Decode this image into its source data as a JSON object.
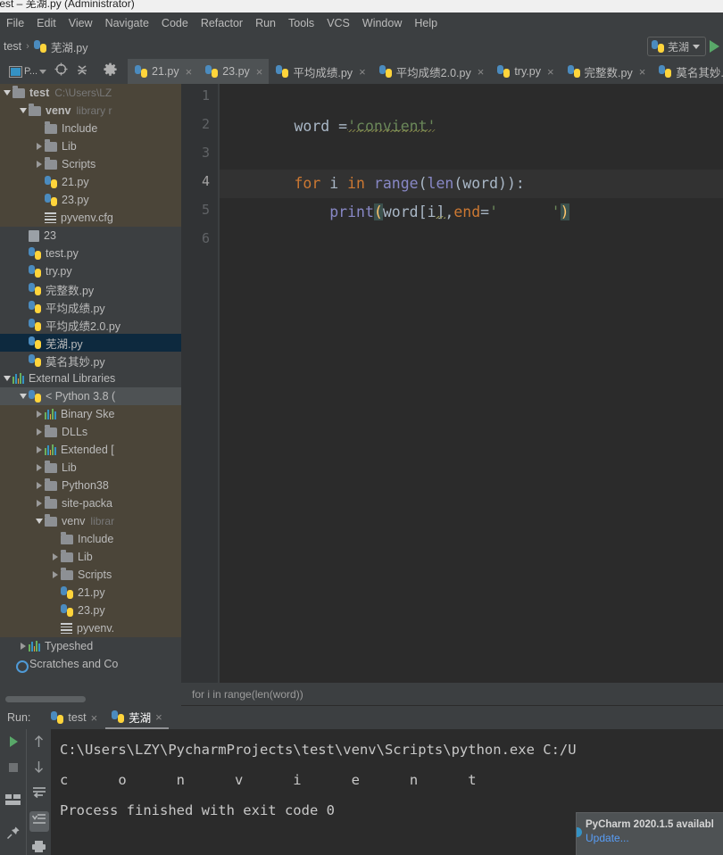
{
  "window": {
    "title": "test – 芜湖.py (Administrator)"
  },
  "menubar": {
    "items": [
      {
        "label": "File"
      },
      {
        "label": "Edit"
      },
      {
        "label": "View"
      },
      {
        "label": "Navigate"
      },
      {
        "label": "Code"
      },
      {
        "label": "Refactor"
      },
      {
        "label": "Run"
      },
      {
        "label": "Tools"
      },
      {
        "label": "VCS"
      },
      {
        "label": "Window"
      },
      {
        "label": "Help"
      }
    ]
  },
  "navbar": {
    "crumbs": [
      "test",
      "芜湖.py"
    ],
    "separator": "›",
    "run_config": "芜湖"
  },
  "toolbar": {
    "project_label": "P...",
    "icons": [
      "project-icon",
      "target-icon",
      "collapse-icon",
      "settings-gear-icon"
    ]
  },
  "tabs": [
    {
      "label": "21.py",
      "active": true
    },
    {
      "label": "23.py",
      "active": true
    },
    {
      "label": "平均成绩.py",
      "active": false
    },
    {
      "label": "平均成绩2.0.py",
      "active": false
    },
    {
      "label": "try.py",
      "active": false
    },
    {
      "label": "完整数.py",
      "active": false
    },
    {
      "label": "莫名其妙.py",
      "active": false
    }
  ],
  "project_tree": [
    {
      "depth": 0,
      "twisty": "down",
      "icon": "folder",
      "label": "test",
      "dim": "C:\\Users\\LZ",
      "bold": true,
      "state": "mod"
    },
    {
      "depth": 1,
      "twisty": "down",
      "icon": "folder",
      "label": "venv",
      "dim": "library r",
      "bold": true,
      "state": "mod"
    },
    {
      "depth": 2,
      "twisty": "none",
      "icon": "folder",
      "label": "Include",
      "dim": "",
      "state": "mod"
    },
    {
      "depth": 2,
      "twisty": "right",
      "icon": "folder",
      "label": "Lib",
      "dim": "",
      "state": "mod"
    },
    {
      "depth": 2,
      "twisty": "right",
      "icon": "folder",
      "label": "Scripts",
      "dim": "",
      "state": "mod"
    },
    {
      "depth": 2,
      "twisty": "none",
      "icon": "python",
      "label": "21.py",
      "dim": "",
      "state": "mod"
    },
    {
      "depth": 2,
      "twisty": "none",
      "icon": "python",
      "label": "23.py",
      "dim": "",
      "state": "mod"
    },
    {
      "depth": 2,
      "twisty": "none",
      "icon": "config",
      "label": "pyvenv.cfg",
      "dim": "",
      "state": "mod"
    },
    {
      "depth": 1,
      "twisty": "none",
      "icon": "text",
      "label": "23",
      "dim": "",
      "state": "none"
    },
    {
      "depth": 1,
      "twisty": "none",
      "icon": "python",
      "label": "test.py",
      "dim": "",
      "state": "none"
    },
    {
      "depth": 1,
      "twisty": "none",
      "icon": "python",
      "label": "try.py",
      "dim": "",
      "state": "none"
    },
    {
      "depth": 1,
      "twisty": "none",
      "icon": "python",
      "label": "完整数.py",
      "dim": "",
      "state": "none"
    },
    {
      "depth": 1,
      "twisty": "none",
      "icon": "python",
      "label": "平均成绩.py",
      "dim": "",
      "state": "none"
    },
    {
      "depth": 1,
      "twisty": "none",
      "icon": "python",
      "label": "平均成绩2.0.py",
      "dim": "",
      "state": "none"
    },
    {
      "depth": 1,
      "twisty": "none",
      "icon": "python",
      "label": "芜湖.py",
      "dim": "",
      "state": "sel"
    },
    {
      "depth": 1,
      "twisty": "none",
      "icon": "python",
      "label": "莫名其妙.py",
      "dim": "",
      "state": "none"
    },
    {
      "depth": 0,
      "twisty": "down",
      "icon": "lib",
      "label": "External Libraries",
      "dim": "",
      "state": "none"
    },
    {
      "depth": 1,
      "twisty": "down",
      "icon": "python",
      "label": "< Python 3.8 (",
      "dim": "",
      "state": "sel-gray"
    },
    {
      "depth": 2,
      "twisty": "right",
      "icon": "lib",
      "label": "Binary Ske",
      "dim": "",
      "state": "mod"
    },
    {
      "depth": 2,
      "twisty": "right",
      "icon": "folder",
      "label": "DLLs",
      "dim": "",
      "state": "mod"
    },
    {
      "depth": 2,
      "twisty": "right",
      "icon": "lib",
      "label": "Extended [",
      "dim": "",
      "state": "mod"
    },
    {
      "depth": 2,
      "twisty": "right",
      "icon": "folder",
      "label": "Lib",
      "dim": "",
      "state": "mod"
    },
    {
      "depth": 2,
      "twisty": "right",
      "icon": "folder",
      "label": "Python38",
      "dim": "",
      "state": "mod"
    },
    {
      "depth": 2,
      "twisty": "right",
      "icon": "folder",
      "label": "site-packa",
      "dim": "",
      "state": "mod"
    },
    {
      "depth": 2,
      "twisty": "down",
      "icon": "folder",
      "label": "venv",
      "dim": "librar",
      "state": "mod"
    },
    {
      "depth": 3,
      "twisty": "none",
      "icon": "folder",
      "label": "Include",
      "dim": "",
      "state": "mod"
    },
    {
      "depth": 3,
      "twisty": "right",
      "icon": "folder",
      "label": "Lib",
      "dim": "",
      "state": "mod"
    },
    {
      "depth": 3,
      "twisty": "right",
      "icon": "folder",
      "label": "Scripts",
      "dim": "",
      "state": "mod"
    },
    {
      "depth": 3,
      "twisty": "none",
      "icon": "python",
      "label": "21.py",
      "dim": "",
      "state": "mod"
    },
    {
      "depth": 3,
      "twisty": "none",
      "icon": "python",
      "label": "23.py",
      "dim": "",
      "state": "mod"
    },
    {
      "depth": 3,
      "twisty": "none",
      "icon": "config",
      "label": "pyvenv.",
      "dim": "",
      "state": "mod"
    },
    {
      "depth": 1,
      "twisty": "right",
      "icon": "lib",
      "label": "Typeshed",
      "dim": "",
      "state": "none"
    },
    {
      "depth": 0,
      "twisty": "none",
      "icon": "scratch",
      "label": "Scratches and Co",
      "dim": "",
      "state": "none"
    }
  ],
  "editor": {
    "line_numbers": [
      "1",
      "2",
      "3",
      "4",
      "5",
      "6"
    ],
    "current_line": 4,
    "lines": [
      "word ='convient'",
      "",
      "for i in range(len(word)):",
      "    print(word[i],end='      ')",
      "",
      ""
    ],
    "breadcrumb": "for i in range(len(word))"
  },
  "run_window": {
    "label": "Run:",
    "tabs": [
      {
        "label": "test",
        "active": false
      },
      {
        "label": "芜湖",
        "active": true
      }
    ],
    "console": [
      "C:\\Users\\LZY\\PycharmProjects\\test\\venv\\Scripts\\python.exe C:/U",
      "c      o      n      v      i      e      n      t",
      "Process finished with exit code 0"
    ],
    "side_icons": [
      "run-icon",
      "stop-icon",
      "layout-icon",
      "pin-icon"
    ],
    "side_icons2": [
      "scroll-up-icon",
      "scroll-down-icon",
      "soft-wrap-icon",
      "scroll-to-end-icon",
      "print-icon"
    ]
  },
  "notification": {
    "title": "PyCharm 2020.1.5 availabl",
    "link": "Update..."
  },
  "colors": {
    "accent": "#4b8bbe",
    "keyword": "#cc7832",
    "string": "#6a8759",
    "function": "#8888c6",
    "default_text": "#a9b7c6",
    "editor_bg": "#2b2b2b",
    "panel_bg": "#3c3f41",
    "selection": "#0d293e",
    "link": "#589df6",
    "run_green": "#59a869"
  }
}
